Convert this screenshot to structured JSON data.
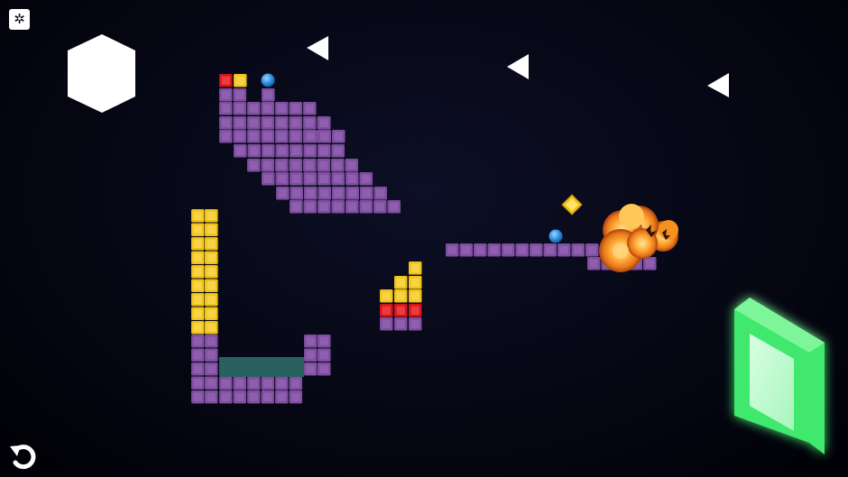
{
  "hud": {
    "settings_icon": "gear-icon",
    "settings_glyph": "✲",
    "restart_icon": "restart-arrow-icon"
  },
  "colors": {
    "block_purple": "#7e4f9e",
    "block_purple_light": "#9c6bbd",
    "block_yellow": "#f0c21a",
    "block_red": "#d4141c",
    "ball_blue": "#2f8fe0",
    "water": "#2e6b68",
    "portal_green": "#3fe86e",
    "explosion": "#ffae3a"
  },
  "scene": {
    "goal": "green-portal",
    "hazards": [
      "explosion"
    ],
    "pieces": [
      "white-hexagon",
      "white-triangle",
      "white-triangle",
      "white-triangle",
      "blue-ball",
      "blue-ball",
      "yellow-diamond"
    ]
  }
}
